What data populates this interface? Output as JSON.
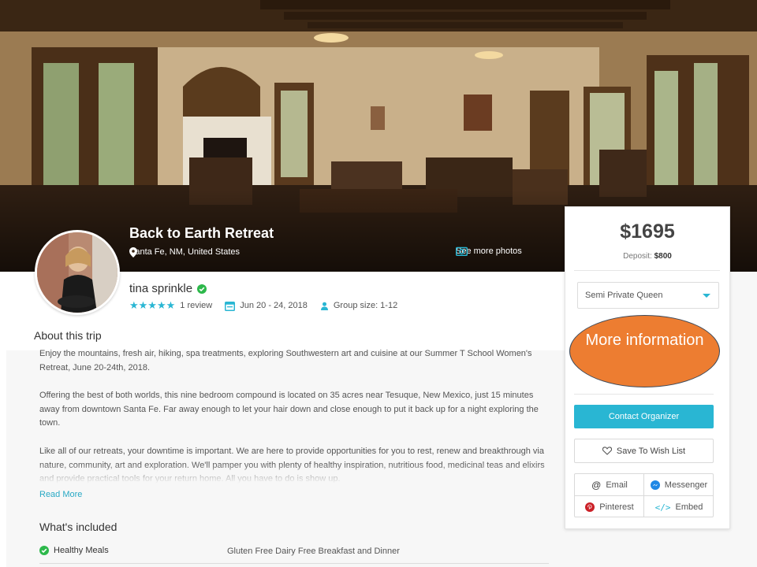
{
  "trip": {
    "title": "Back to Earth Retreat",
    "location": "Santa Fe, NM, United States",
    "see_photos_label": "See more photos"
  },
  "host": {
    "name": "tina sprinkle",
    "rating_stars": 5,
    "reviews": "1 review",
    "dates": "Jun 20 - 24, 2018",
    "group_size": "Group size: 1-12"
  },
  "about": {
    "title": "About this trip",
    "paragraphs": [
      "Enjoy the mountains, fresh air, hiking, spa treatments, exploring Southwestern art and cuisine at our Summer T School Women's Retreat, June 20-24th, 2018.",
      "Offering the best of both worlds, this nine bedroom compound is located on 35 acres near Tesuque, New Mexico, just 15 minutes away from downtown Santa Fe. Far away enough to let your hair down and close enough to put it back up for a night exploring the town.",
      "Like all of our retreats, your downtime is important.  We are here to provide opportunities for you to rest, renew and breakthrough via nature, community, art and exploration.  We'll pamper you with plenty of healthy inspiration, nutritious food, medicinal teas and elixirs and provide practical tools for your return home.  All you have to do is show up."
    ],
    "read_more": "Read More"
  },
  "included": {
    "title": "What's included",
    "items": [
      {
        "label": "Healthy Meals",
        "value": "Gluten Free Dairy Free Breakfast and Dinner"
      }
    ]
  },
  "booking": {
    "price": "$1695",
    "deposit_label": "Deposit:",
    "deposit_value": "$800",
    "room_option": "Semi Private Queen",
    "callout": "More information",
    "contact_label": "Contact Organizer",
    "wishlist_label": "Save To Wish List",
    "share": {
      "email": "Email",
      "messenger": "Messenger",
      "pinterest": "Pinterest",
      "embed": "Embed"
    }
  },
  "colors": {
    "accent": "#29b6d3",
    "callout": "#ed7d31",
    "verified": "#2db84b",
    "pinterest": "#cb2027",
    "messenger": "#1e88e5"
  }
}
